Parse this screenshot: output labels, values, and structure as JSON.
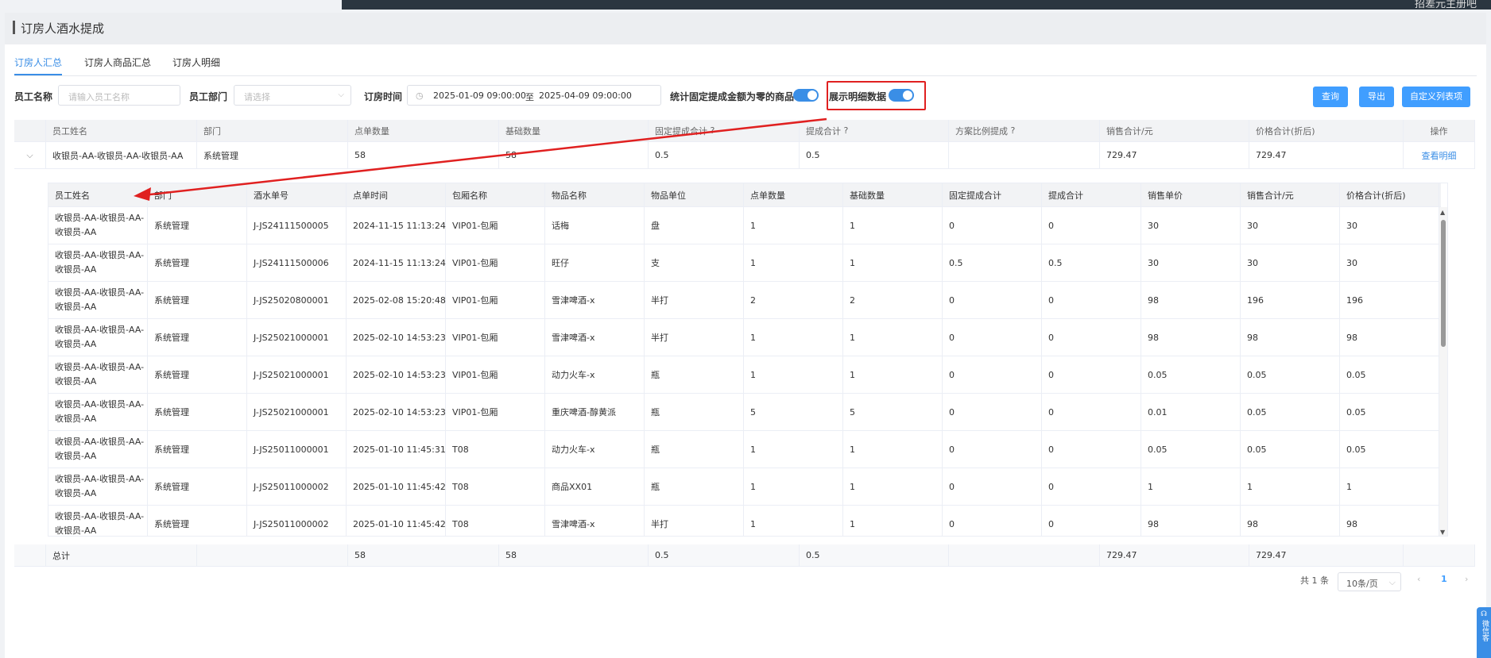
{
  "header": {
    "user": "招差元主册吧"
  },
  "page": {
    "title": "订房人酒水提成"
  },
  "tabs": [
    "订房人汇总",
    "订房人商品汇总",
    "订房人明细"
  ],
  "filters": {
    "employee_name_label": "员工名称",
    "employee_name_placeholder": "请输入员工名称",
    "department_label": "员工部门",
    "department_placeholder": "请选择",
    "booking_time_label": "订房时间",
    "date_start": "2025-01-09 09:00:00",
    "date_sep": "至",
    "date_end": "2025-04-09 09:00:00",
    "zero_commission_label": "统计固定提成金额为零的商品",
    "show_detail_label": "展示明细数据"
  },
  "buttons": {
    "query": "查询",
    "export": "导出",
    "custom_columns": "自定义列表项"
  },
  "summary_table": {
    "headers": [
      "员工姓名",
      "部门",
      "点单数量",
      "基础数量",
      "固定提成合计",
      "提成合计",
      "方案比例提成",
      "销售合计/元",
      "价格合计(折后)",
      "操作"
    ],
    "row": [
      "收银员-AA-收银员-AA-收银员-AA",
      "系统管理",
      "58",
      "58",
      "0.5",
      "0.5",
      "",
      "729.47",
      "729.47",
      "查看明细"
    ],
    "total": [
      "总计",
      "",
      "58",
      "58",
      "0.5",
      "0.5",
      "",
      "729.47",
      "729.47",
      ""
    ]
  },
  "detail_table": {
    "headers": [
      "员工姓名",
      "部门",
      "酒水单号",
      "点单时间",
      "包厢名称",
      "物品名称",
      "物品单位",
      "点单数量",
      "基础数量",
      "固定提成合计",
      "提成合计",
      "销售单价",
      "销售合计/元",
      "价格合计(折后)"
    ],
    "rows": [
      [
        "收银员-AA-收银员-AA-收银员-AA",
        "系统管理",
        "J-JS24111500005",
        "2024-11-15 11:13:24",
        "VIP01-包厢",
        "话梅",
        "盘",
        "1",
        "1",
        "0",
        "0",
        "30",
        "30",
        "30"
      ],
      [
        "收银员-AA-收银员-AA-收银员-AA",
        "系统管理",
        "J-JS24111500006",
        "2024-11-15 11:13:24",
        "VIP01-包厢",
        "旺仔",
        "支",
        "1",
        "1",
        "0.5",
        "0.5",
        "30",
        "30",
        "30"
      ],
      [
        "收银员-AA-收银员-AA-收银员-AA",
        "系统管理",
        "J-JS25020800001",
        "2025-02-08 15:20:48",
        "VIP01-包厢",
        "雪津啤酒-x",
        "半打",
        "2",
        "2",
        "0",
        "0",
        "98",
        "196",
        "196"
      ],
      [
        "收银员-AA-收银员-AA-收银员-AA",
        "系统管理",
        "J-JS25021000001",
        "2025-02-10 14:53:23",
        "VIP01-包厢",
        "雪津啤酒-x",
        "半打",
        "1",
        "1",
        "0",
        "0",
        "98",
        "98",
        "98"
      ],
      [
        "收银员-AA-收银员-AA-收银员-AA",
        "系统管理",
        "J-JS25021000001",
        "2025-02-10 14:53:23",
        "VIP01-包厢",
        "动力火车-x",
        "瓶",
        "1",
        "1",
        "0",
        "0",
        "0.05",
        "0.05",
        "0.05"
      ],
      [
        "收银员-AA-收银员-AA-收银员-AA",
        "系统管理",
        "J-JS25021000001",
        "2025-02-10 14:53:23",
        "VIP01-包厢",
        "重庆啤酒-醇黄派",
        "瓶",
        "5",
        "5",
        "0",
        "0",
        "0.01",
        "0.05",
        "0.05"
      ],
      [
        "收银员-AA-收银员-AA-收银员-AA",
        "系统管理",
        "J-JS25011000001",
        "2025-01-10 11:45:31",
        "T08",
        "动力火车-x",
        "瓶",
        "1",
        "1",
        "0",
        "0",
        "0.05",
        "0.05",
        "0.05"
      ],
      [
        "收银员-AA-收银员-AA-收银员-AA",
        "系统管理",
        "J-JS25011000002",
        "2025-01-10 11:45:42",
        "T08",
        "商品XX01",
        "瓶",
        "1",
        "1",
        "0",
        "0",
        "1",
        "1",
        "1"
      ],
      [
        "收银员-AA-收银员-AA-收银员-AA",
        "系统管理",
        "J-JS25011000002",
        "2025-01-10 11:45:42",
        "T08",
        "雪津啤酒-x",
        "半打",
        "1",
        "1",
        "0",
        "0",
        "98",
        "98",
        "98"
      ]
    ]
  },
  "pagination": {
    "total": "共 1 条",
    "page_size": "10条/页",
    "current_page": "1"
  },
  "side_widget": {
    "label": "微信客"
  },
  "colors": {
    "accent": "#409eff",
    "annotation": "#e02020"
  }
}
